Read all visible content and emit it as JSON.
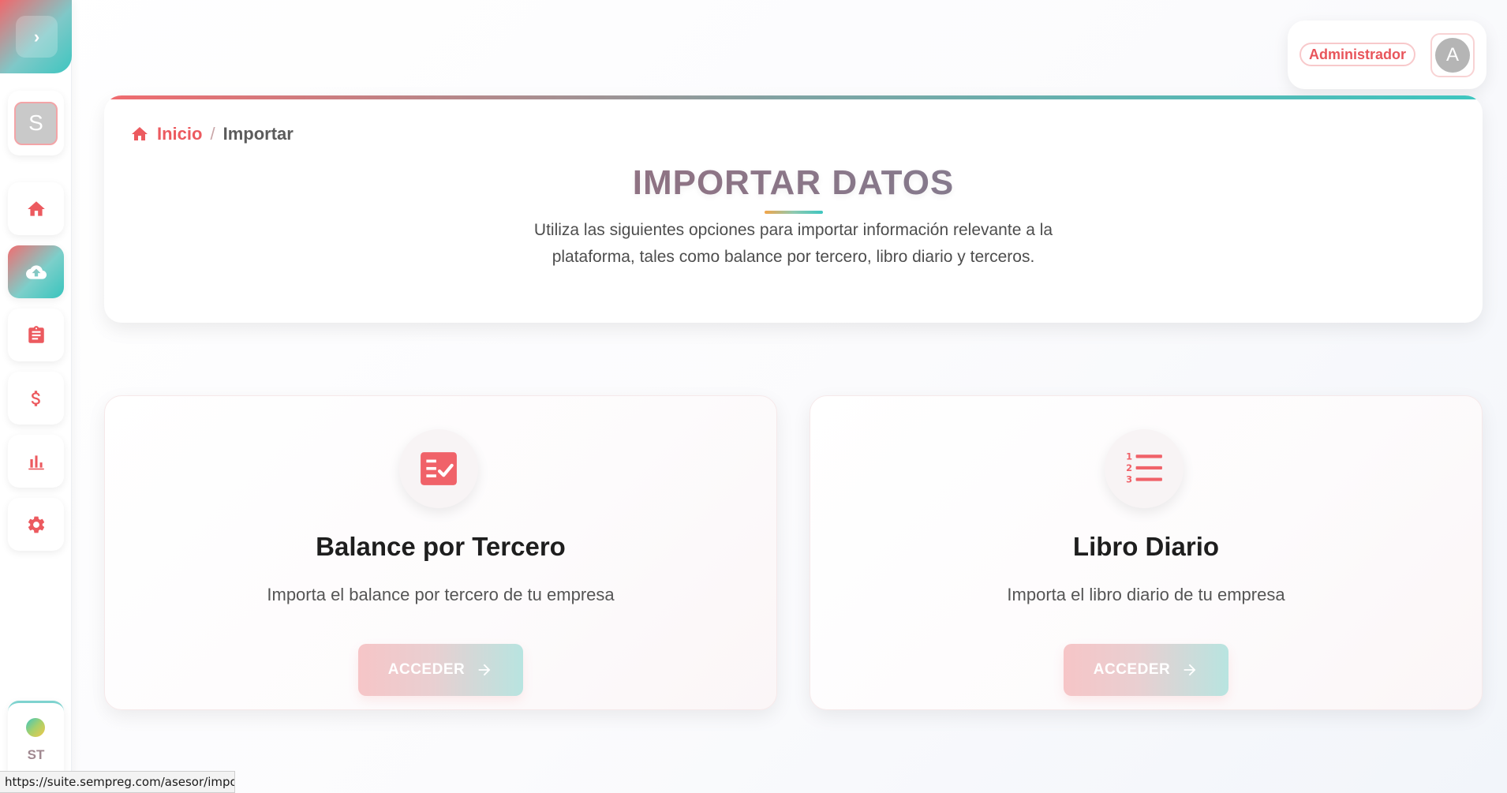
{
  "sidebar": {
    "toggle_glyph": "›",
    "company_initial": "S",
    "nav": [
      {
        "icon": "home-icon",
        "active": false
      },
      {
        "icon": "cloud-upload-icon",
        "active": true
      },
      {
        "icon": "clipboard-icon",
        "active": false
      },
      {
        "icon": "dollar-icon",
        "active": false
      },
      {
        "icon": "bar-chart-icon",
        "active": false
      },
      {
        "icon": "gear-icon",
        "active": false
      }
    ],
    "user_initials": "ST"
  },
  "profile": {
    "role": "Administrador",
    "avatar_initial": "A"
  },
  "breadcrumb": {
    "home": "Inicio",
    "separator": "/",
    "current": "Importar"
  },
  "header": {
    "title": "IMPORTAR DATOS",
    "description": "Utiliza las siguientes opciones para importar información relevante a la plataforma, tales como balance por tercero, libro diario y terceros."
  },
  "options": [
    {
      "icon": "checklist-icon",
      "title": "Balance por Tercero",
      "description": "Importa el balance por tercero de tu empresa",
      "button": "ACCEDER"
    },
    {
      "icon": "numbered-list-icon",
      "title": "Libro Diario",
      "description": "Importa el libro diario de tu empresa",
      "button": "ACCEDER"
    }
  ],
  "colors": {
    "accent": "#ec5a5f",
    "teal": "#3ec6c0"
  },
  "status_bar": {
    "url": "https://suite.sempreg.com/asesor/importar"
  }
}
